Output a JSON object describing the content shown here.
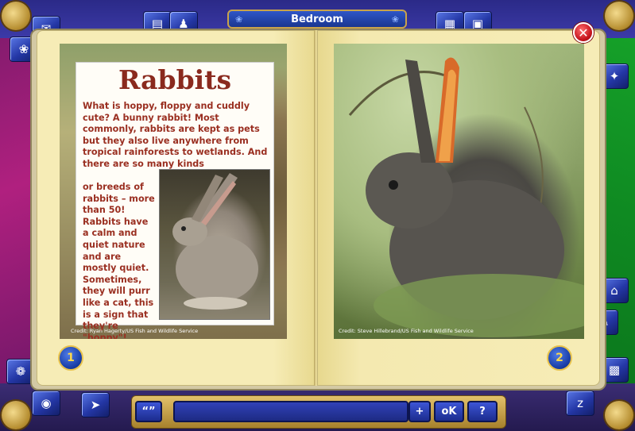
{
  "window": {
    "title": "Bedroom"
  },
  "book": {
    "left_page": {
      "heading": "Rabbits",
      "body_top": "What is hoppy, floppy and cuddly cute? A bunny rabbit!  Most commonly, rabbits are kept as pets but they also live anywhere from tropical rainforests to wetlands.  And there are so many kinds",
      "body_side": "or breeds of rabbits – more than 50! Rabbits have a calm and quiet nature and are mostly quiet. Sometimes, they will purr like a cat, this is a sign that they're \"hoppy\"!",
      "credit": "Credit: Ryan Hagerty/US Fish and Wildlife Service",
      "page_number": "1"
    },
    "right_page": {
      "credit": "Credit: Steve Hillebrand/US Fish and Wildlife Service",
      "page_number": "2"
    }
  },
  "controls": {
    "close_label": "✕",
    "plus_label": "+",
    "ok_label": "oK",
    "help_label": "?",
    "speak_label": "“”"
  },
  "colors": {
    "heading": "#8a2a1e",
    "body_text": "#9a2f21",
    "accent_blue": "#2437a6",
    "gold": "#c9a34a"
  }
}
